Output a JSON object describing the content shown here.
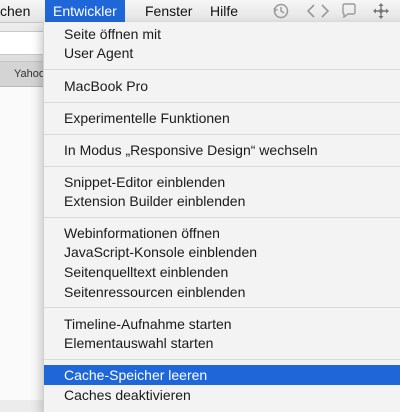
{
  "menubar": {
    "items": [
      {
        "label": "chen"
      },
      {
        "label": "Entwickler"
      },
      {
        "label": "Fenster"
      },
      {
        "label": "Hilfe"
      }
    ],
    "icons": [
      "history-clock-icon",
      "code-brackets-icon",
      "speech-bubble-icon",
      "move-arrows-icon"
    ]
  },
  "background": {
    "tab_label": "Yahoo"
  },
  "dropdown": {
    "items": [
      {
        "label": "Seite öffnen mit"
      },
      {
        "label": "User Agent"
      },
      {
        "label": "MacBook Pro"
      },
      {
        "label": "Experimentelle Funktionen"
      },
      {
        "label": "In Modus „Responsive Design“ wechseln"
      },
      {
        "label": "Snippet-Editor einblenden"
      },
      {
        "label": "Extension Builder einblenden"
      },
      {
        "label": "Webinformationen öffnen"
      },
      {
        "label": "JavaScript-Konsole einblenden"
      },
      {
        "label": "Seitenquelltext einblenden"
      },
      {
        "label": "Seitenressourcen einblenden"
      },
      {
        "label": "Timeline-Aufnahme starten"
      },
      {
        "label": "Elementauswahl starten"
      },
      {
        "label": "Cache-Speicher leeren"
      },
      {
        "label": "Caches deaktivieren"
      }
    ]
  },
  "colors": {
    "highlight": "#1f67d8",
    "menu_background": "#f3f3f3",
    "separator": "#d9d9d9"
  }
}
